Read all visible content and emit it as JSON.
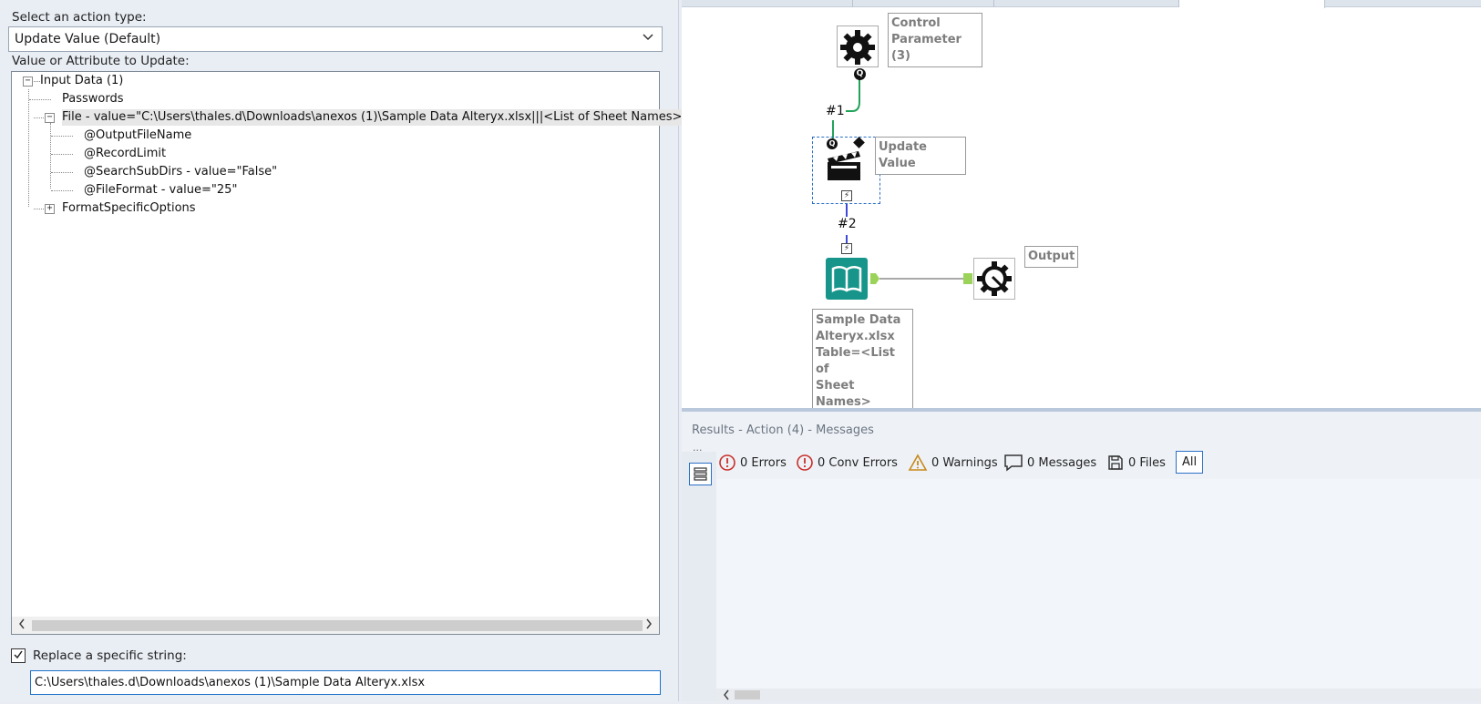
{
  "left_panel": {
    "action_type_label": "Select an action type:",
    "action_type_value": "Update Value (Default)",
    "value_attr_label": "Value or Attribute to Update:",
    "tree": {
      "root": "Input Data (1)",
      "passwords": "Passwords",
      "file": "File - value=\"C:\\Users\\thales.d\\Downloads\\anexos (1)\\Sample Data Alteryx.xlsx|||<List of Sheet Names>",
      "output_file_name": "@OutputFileName",
      "record_limit": "@RecordLimit",
      "search_sub_dirs": "@SearchSubDirs - value=\"False\"",
      "file_format": "@FileFormat - value=\"25\"",
      "format_specific": "FormatSpecificOptions"
    },
    "replace_label": "Replace a specific string:",
    "replace_checked": true,
    "replace_value": "C:\\Users\\thales.d\\Downloads\\anexos (1)\\Sample Data Alteryx.xlsx"
  },
  "canvas": {
    "control_parameter_label": "Control Parameter (3)",
    "update_value_label": "Update Value",
    "connection_1": "#1",
    "connection_2": "#2",
    "input_label": "Sample Data Alteryx.xlsx Table=<List of Sheet Names>",
    "input_label_lines": [
      "Sample Data",
      "Alteryx.xlsx",
      "Table=<List of",
      "Sheet Names>"
    ],
    "output_label": "Output",
    "colors": {
      "input_tool": "#17958a",
      "connector_green": "#23a35a",
      "connector_blue": "#3d4bd6",
      "anchor_green": "#9bd35a"
    }
  },
  "results": {
    "title": "Results - Action (4) - Messages",
    "errors": "0 Errors",
    "conv_errors": "0 Conv Errors",
    "warnings": "0 Warnings",
    "messages": "0 Messages",
    "files": "0 Files",
    "all": "All"
  }
}
